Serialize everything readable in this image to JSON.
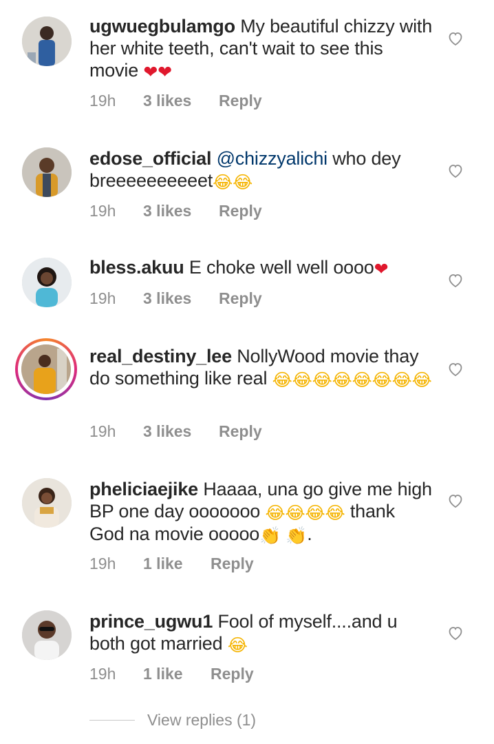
{
  "comments": [
    {
      "username": "ugwuegbulamgo",
      "text": "My beautiful chizzy with her white teeth, can't wait to see this movie",
      "time": "19h",
      "likes": "3 likes",
      "reply": "Reply"
    },
    {
      "username": "edose_official",
      "mention": "@chizzyalichi",
      "text": "who dey breeeeeeeeeet",
      "time": "19h",
      "likes": "3 likes",
      "reply": "Reply"
    },
    {
      "username": "bless.akuu",
      "text": "E choke well well oooo",
      "time": "19h",
      "likes": "3 likes",
      "reply": "Reply"
    },
    {
      "username": "real_destiny_lee",
      "text": "NollyWood  movie thay do something like real",
      "time": "19h",
      "likes": "3 likes",
      "reply": "Reply"
    },
    {
      "username": "pheliciaejike",
      "text": "Haaaa, una go give me high BP one day ooooooo",
      "text2": "thank God na movie ooooo",
      "text3": ".",
      "time": "19h",
      "likes": "1 like",
      "reply": "Reply"
    },
    {
      "username": "prince_ugwu1",
      "text": "Fool of myself....and u both got married",
      "time": "19h",
      "likes": "1 like",
      "reply": "Reply"
    }
  ],
  "view_replies": "View replies (1)",
  "icons": {
    "heart_emoji": "❤",
    "laugh_emoji": "😂",
    "clap_emoji": "👏",
    "like": "heart-outline-icon"
  },
  "colors": {
    "text": "#262626",
    "meta": "#8e8e8e",
    "mention": "#00376b"
  }
}
